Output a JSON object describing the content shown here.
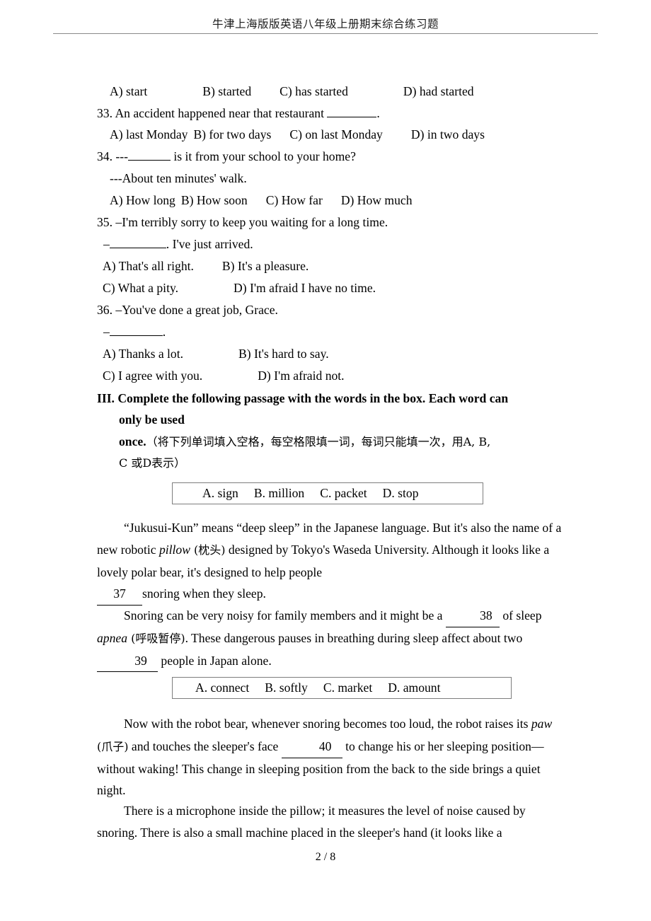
{
  "document": {
    "header_title": "牛津上海版版英语八年级上册期末综合练习题",
    "footer": "2 / 8"
  },
  "questions": [
    {
      "id": "q32-options",
      "options_line": "A) start",
      "opt_a": "A) start",
      "opt_b": "B) started",
      "opt_c": "C) has started",
      "opt_d": "D) had started"
    },
    {
      "id": "q33",
      "number": "33.",
      "stem_before": "An accident happened near that restaurant",
      "stem_after": ".",
      "opt_a": "A) last Monday",
      "opt_b": "B) for two days",
      "opt_c": "C) on last Monday",
      "opt_d": "D) in two days"
    },
    {
      "id": "q34",
      "number": "34.",
      "stem_before": "---",
      "stem_after": "is it from your school to your home?",
      "reply": "---About ten minutes' walk.",
      "opt_a": "A) How long",
      "opt_b": "B) How soon",
      "opt_c": "C) How far",
      "opt_d": "D) How much"
    },
    {
      "id": "q35",
      "number": "35.",
      "stem": "–I'm terribly sorry to keep you waiting for a long time.",
      "reply_prefix": "–",
      "reply_after": ". I've just arrived.",
      "opt_a": "A) That's all right.",
      "opt_b": "B) It's a pleasure.",
      "opt_c": "C) What a pity.",
      "opt_d": "D) I'm afraid I have no time."
    },
    {
      "id": "q36",
      "number": "36.",
      "stem": "–You've done a great job, Grace.",
      "reply_prefix": "–",
      "reply_after": ".",
      "opt_a": "A) Thanks a lot.",
      "opt_b": "B) It's hard to say.",
      "opt_c": "C) I agree with you.",
      "opt_d": "D) I'm afraid not."
    }
  ],
  "section3": {
    "heading_line1": "III. Complete the following passage with the words in the box. Each word can",
    "heading_line2": "only be used",
    "heading_line3_en": "once.",
    "heading_line3_cn": "（将下列单词填入空格，每空格限填一词，每词只能填一次，用A, B,",
    "heading_line4_cn": "C 或D表示）"
  },
  "wordbox1": {
    "a": "A. sign",
    "b": "B. million",
    "c": "C. packet",
    "d": "D. stop"
  },
  "wordbox2": {
    "a": "A. connect",
    "b": "B. softly",
    "c": "C. market",
    "d": "D. amount"
  },
  "passage": {
    "p1_part1": "“Jukusui-Kun” means “deep sleep” in the Japanese language. But it's also the name of a new robotic ",
    "p1_italic": "pillow",
    "p1_gloss": " (枕头)",
    "p1_part2": " designed by Tokyo's Waseda University. Although it looks like a lovely polar bear, it's designed to help people",
    "p1_blank": "37",
    "p1_part3": "snoring when they sleep.",
    "p2_part1": "Snoring can be very noisy for family members and it might be a",
    "p2_blank": "38",
    "p2_part2": "of sleep ",
    "p2_italic": "apnea",
    "p2_gloss": " (呼吸暂停)",
    "p2_part3": ". These dangerous pauses in breathing during sleep affect about two",
    "p2_blank2": "39",
    "p2_part4": "people in Japan alone.",
    "p3_part1": "Now with the robot bear, whenever snoring becomes too loud, the robot raises its ",
    "p3_italic": "paw",
    "p3_gloss": " (爪子)",
    "p3_part2": " and touches the sleeper's face",
    "p3_blank": "40",
    "p3_part3": "to change his or her sleeping position—without waking! This change in sleeping position from the back to the side brings a quiet night.",
    "p4": "There is a microphone inside the pillow; it measures the level of noise caused by snoring. There is also a small machine placed in the sleeper's hand (it looks like a"
  }
}
